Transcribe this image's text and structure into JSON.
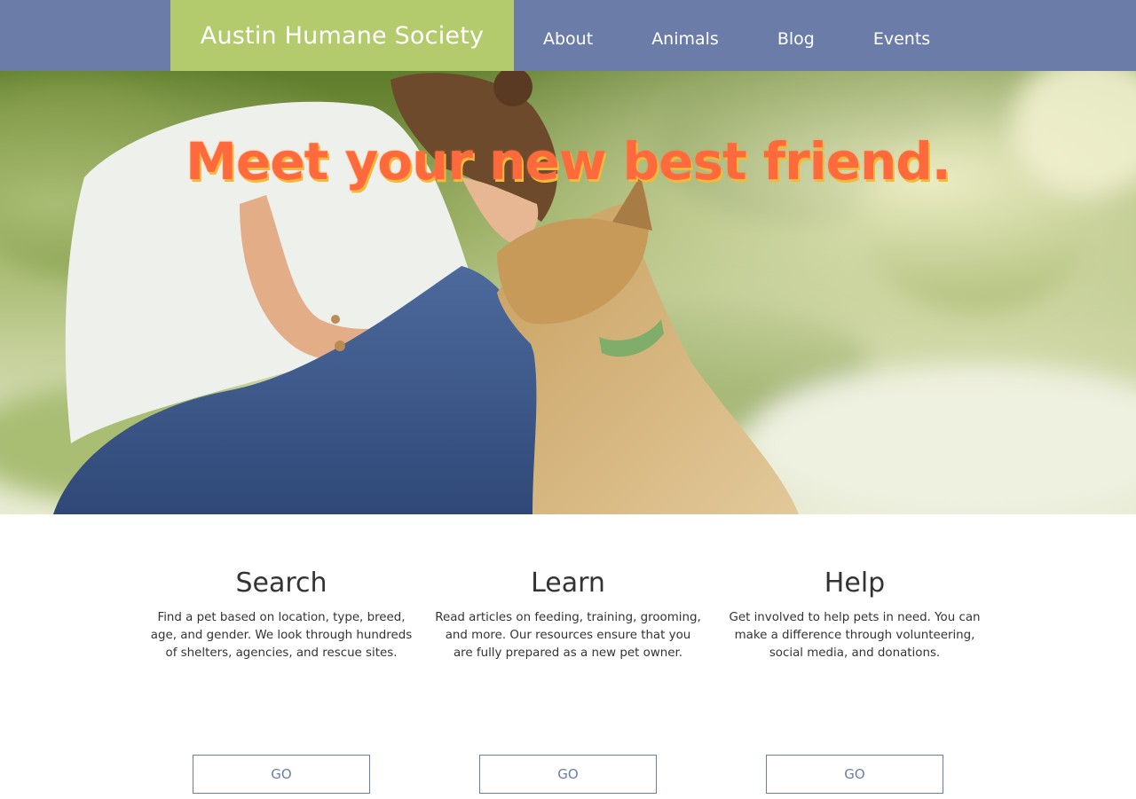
{
  "header": {
    "brand": "Austin Humane Society",
    "nav": [
      {
        "label": "About"
      },
      {
        "label": "Animals"
      },
      {
        "label": "Blog"
      },
      {
        "label": "Events"
      }
    ]
  },
  "hero": {
    "title": "Meet your new best friend.",
    "image": "woman-hugging-dog-photo"
  },
  "features": [
    {
      "title": "Search",
      "text": "Find a pet based on location, type, breed, age, and gender. We look through hundreds of shelters, agencies, and rescue sites.",
      "button": "GO"
    },
    {
      "title": "Learn",
      "text": "Read articles on feeding, training, grooming, and more. Our resources ensure that you are fully prepared as a new pet owner.",
      "button": "GO"
    },
    {
      "title": "Help",
      "text": "Get involved to help pets in need. You can make a difference through volunteering, social media, and donations.",
      "button": "GO"
    }
  ],
  "colors": {
    "nav_bg": "#6b7ca9",
    "brand_bg": "#b3cb6d",
    "hero_title": "#ff6a3d",
    "hero_title_shadow": "#f2b93a",
    "button_border": "#6b7ca9"
  }
}
